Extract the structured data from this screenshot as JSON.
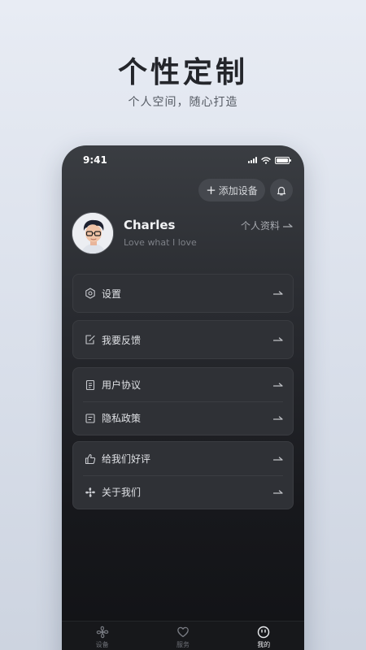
{
  "hero": {
    "title": "个性定制",
    "subtitle": "个人空间，随心打造"
  },
  "status_bar": {
    "time": "9:41"
  },
  "header": {
    "add_device_label": "添加设备",
    "add_icon": "plus-icon",
    "bell_icon": "bell-icon"
  },
  "profile": {
    "name": "Charles",
    "bio": "Love what I love",
    "link_label": "个人资料",
    "avatar_icon": "avatar-illustration"
  },
  "menu": {
    "settings": {
      "label": "设置",
      "icon": "settings-icon"
    },
    "feedback": {
      "label": "我要反馈",
      "icon": "feedback-icon"
    },
    "agreement": {
      "label": "用户协议",
      "icon": "document-icon"
    },
    "privacy": {
      "label": "隐私政策",
      "icon": "policy-icon"
    },
    "rate": {
      "label": "给我们好评",
      "icon": "thumbs-up-icon"
    },
    "about": {
      "label": "关于我们",
      "icon": "fan-icon"
    }
  },
  "tabs": [
    {
      "label": "设备",
      "icon": "fan-icon",
      "active": false
    },
    {
      "label": "服务",
      "icon": "heart-icon",
      "active": false
    },
    {
      "label": "我的",
      "icon": "face-icon",
      "active": true
    }
  ]
}
